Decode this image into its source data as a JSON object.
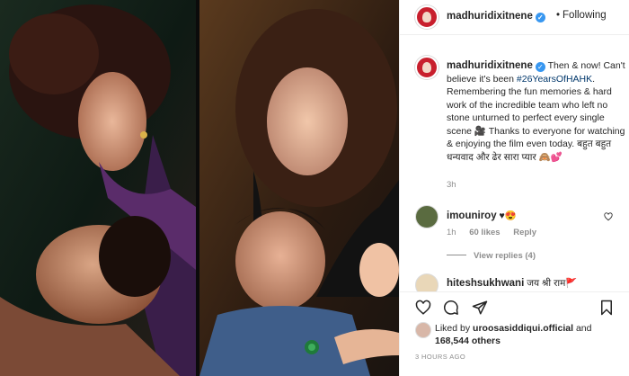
{
  "post": {
    "username": "madhuridixitnene",
    "verified": true,
    "follow_label": "Following",
    "follow_dot": "•"
  },
  "caption": {
    "username": "madhuridixitnene",
    "before": "Then & now! Can't believe it's been ",
    "hashtag": "#26YearsOfHAHK",
    "after": ". Remembering the fun memories & hard work of the incredible team who left no stone unturned to perfect every single scene 🎥 Thanks to everyone for watching & enjoying the film even today. बहुत बहुत धन्यवाद और ढेर सारा प्यार 🙈💕",
    "time": "3h"
  },
  "comments": [
    {
      "username": "imouniroy",
      "text": "♥😍",
      "time": "1h",
      "likes": "60 likes",
      "reply_label": "Reply",
      "view_replies": "View replies (4)"
    },
    {
      "username": "hiteshsukhwani",
      "text": "जय श्री राम🚩"
    }
  ],
  "likes": {
    "prefix": "Liked by ",
    "user": "uroosasiddiqui.official",
    "middle": " and ",
    "count": "168,544 others"
  },
  "timestamp": "3 HOURS AGO",
  "icons": [
    "heart-icon",
    "comment-icon",
    "share-icon",
    "bookmark-icon",
    "verified-icon"
  ],
  "colors": {
    "accent": "#3897f0",
    "link": "#00376b",
    "muted": "#8e8e8e",
    "text": "#262626"
  }
}
